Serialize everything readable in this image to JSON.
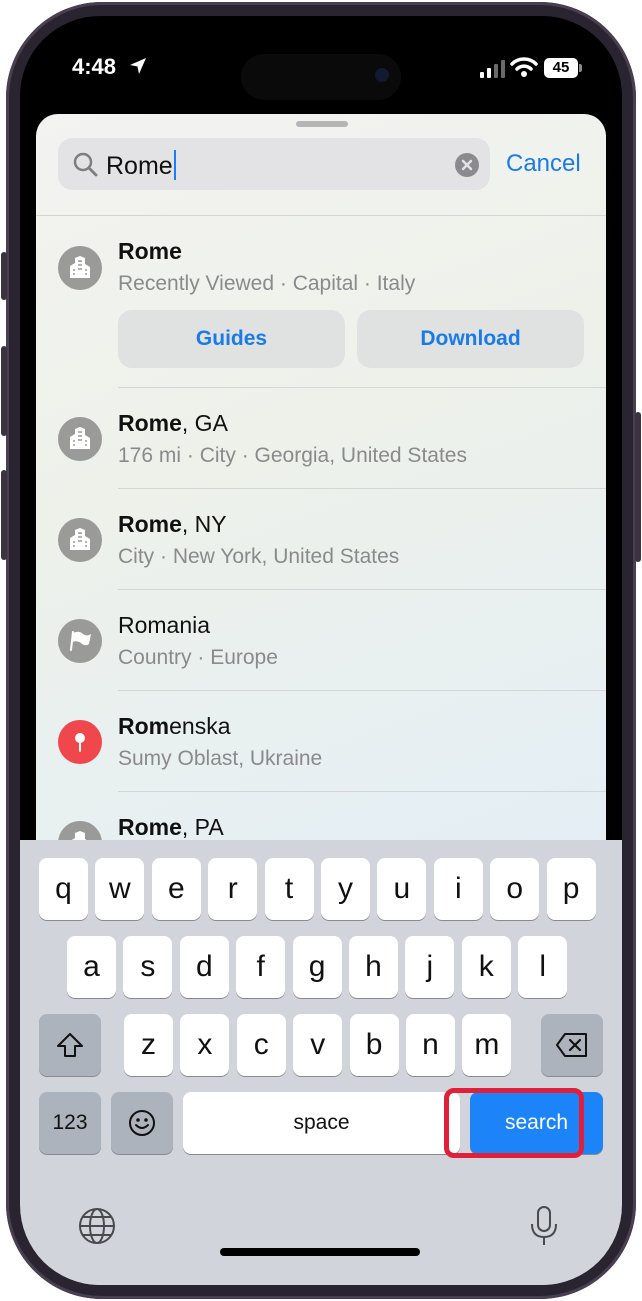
{
  "status": {
    "time": "4:48",
    "battery": "45"
  },
  "search": {
    "query": "Rome",
    "cancel_label": "Cancel"
  },
  "results": [
    {
      "bold": "Rome",
      "rest": "",
      "subtitle": "Recently Viewed · Capital · Italy",
      "icon": "city-icon"
    },
    {
      "bold": "Rome",
      "rest": ", GA",
      "subtitle": "176 mi · City · Georgia, United States",
      "icon": "city-icon"
    },
    {
      "bold": "Rome",
      "rest": ", NY",
      "subtitle": "City · New York, United States",
      "icon": "city-icon"
    },
    {
      "bold": "",
      "rest": "Romania",
      "subtitle": "Country · Europe",
      "icon": "flag-icon"
    },
    {
      "bold": "Rom",
      "rest": "enska",
      "subtitle": "Sumy Oblast, Ukraine",
      "icon": "pin-icon"
    },
    {
      "bold": "Rome",
      "rest": ", PA",
      "subtitle": "",
      "icon": "city-icon"
    }
  ],
  "actions": {
    "guides_label": "Guides",
    "download_label": "Download"
  },
  "keyboard": {
    "row1": [
      "q",
      "w",
      "e",
      "r",
      "t",
      "y",
      "u",
      "i",
      "o",
      "p"
    ],
    "row2": [
      "a",
      "s",
      "d",
      "f",
      "g",
      "h",
      "j",
      "k",
      "l"
    ],
    "row3": [
      "z",
      "x",
      "c",
      "v",
      "b",
      "n",
      "m"
    ],
    "numbers_label": "123",
    "space_label": "space",
    "search_label": "search"
  },
  "colors": {
    "accent": "#1a7be8",
    "highlight": "#e0203a",
    "pin": "#f0474d"
  }
}
